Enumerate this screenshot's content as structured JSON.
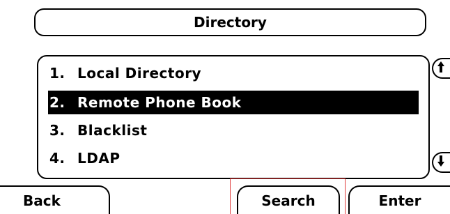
{
  "header": {
    "title": "Directory"
  },
  "menu": {
    "items": [
      {
        "number": "1.",
        "label": "Local Directory",
        "selected": false
      },
      {
        "number": "2.",
        "label": "Remote Phone Book",
        "selected": true
      },
      {
        "number": "3.",
        "label": "Blacklist",
        "selected": false
      },
      {
        "number": "4.",
        "label": "LDAP",
        "selected": false
      }
    ]
  },
  "scroll": {
    "up_icon": "arrow-up-icon",
    "down_icon": "arrow-down-icon"
  },
  "softkeys": {
    "back": "Back",
    "search": "Search",
    "enter": "Enter"
  },
  "colors": {
    "foreground": "#000000",
    "background": "#ffffff",
    "selection": "#000000",
    "highlight": "#e03a3a"
  }
}
